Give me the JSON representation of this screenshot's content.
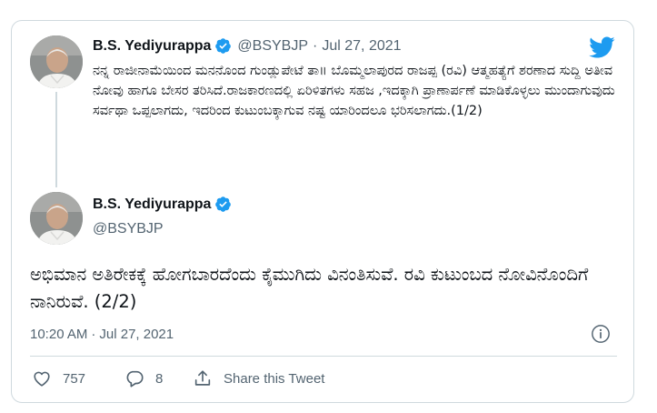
{
  "tweet1": {
    "author_name": "B.S. Yediyurappa",
    "handle": "@BSYBJP",
    "separator": "·",
    "date": "Jul 27, 2021",
    "text": "ನನ್ನ ರಾಜೀನಾಮೆಯಿಂದ ಮನನೊಂದ ಗುಂಡ್ಲುಪೇಟೆ ತಾ॥ ಬೊಮ್ಮಲಾಪುರದ ರಾಜಪ್ಪ (ರವಿ) ಆತ್ಮಹತ್ಯೆಗೆ ಶರಣಾದ ಸುದ್ದಿ ಅತೀವ ನೋವು ಹಾಗೂ ಬೇಸರ ತರಿಸಿದೆ.ರಾಜಕಾರಣದಲ್ಲಿ ಏರಿಳಿತಗಳು ಸಹಜ ,ಇದಕ್ಕಾಗಿ ಪ್ರಾಣಾರ್ಪಣೆ ಮಾಡಿಕೊಳ್ಳಲು ಮುಂದಾಗುವುದು ಸರ್ವಥಾ ಒಪ್ಪಲಾಗದು, ಇದರಿಂದ ಕುಟುಂಬಕ್ಕಾಗುವ ನಷ್ಟ ಯಾರಿಂದಲೂ ಭರಿಸಲಾಗದು.(1/2)"
  },
  "tweet2": {
    "author_name": "B.S. Yediyurappa",
    "handle": "@BSYBJP",
    "text": "ಅಭಿಮಾನ ಅತಿರೇಕಕ್ಕೆ ಹೋಗಬಾರದೆಂದು ಕೈಮುಗಿದು ವಿನಂತಿಸುವೆ. ರವಿ ಕುಟುಂಬದ ನೋವಿನೊಂದಿಗೆ ನಾನಿರುವೆ. (2/2)",
    "time": "10:20 AM",
    "separator": "·",
    "date": "Jul 27, 2021"
  },
  "actions": {
    "like_count": "757",
    "reply_count": "8",
    "share_label": "Share this Tweet"
  },
  "colors": {
    "brand_blue": "#1d9bf0",
    "secondary_text": "#536471",
    "border": "#cfd9de"
  },
  "icons": {
    "logo": "twitter-bird-icon",
    "verified": "verified-badge-icon",
    "info": "info-icon",
    "like": "heart-icon",
    "reply": "reply-bubble-icon",
    "share": "share-icon"
  }
}
